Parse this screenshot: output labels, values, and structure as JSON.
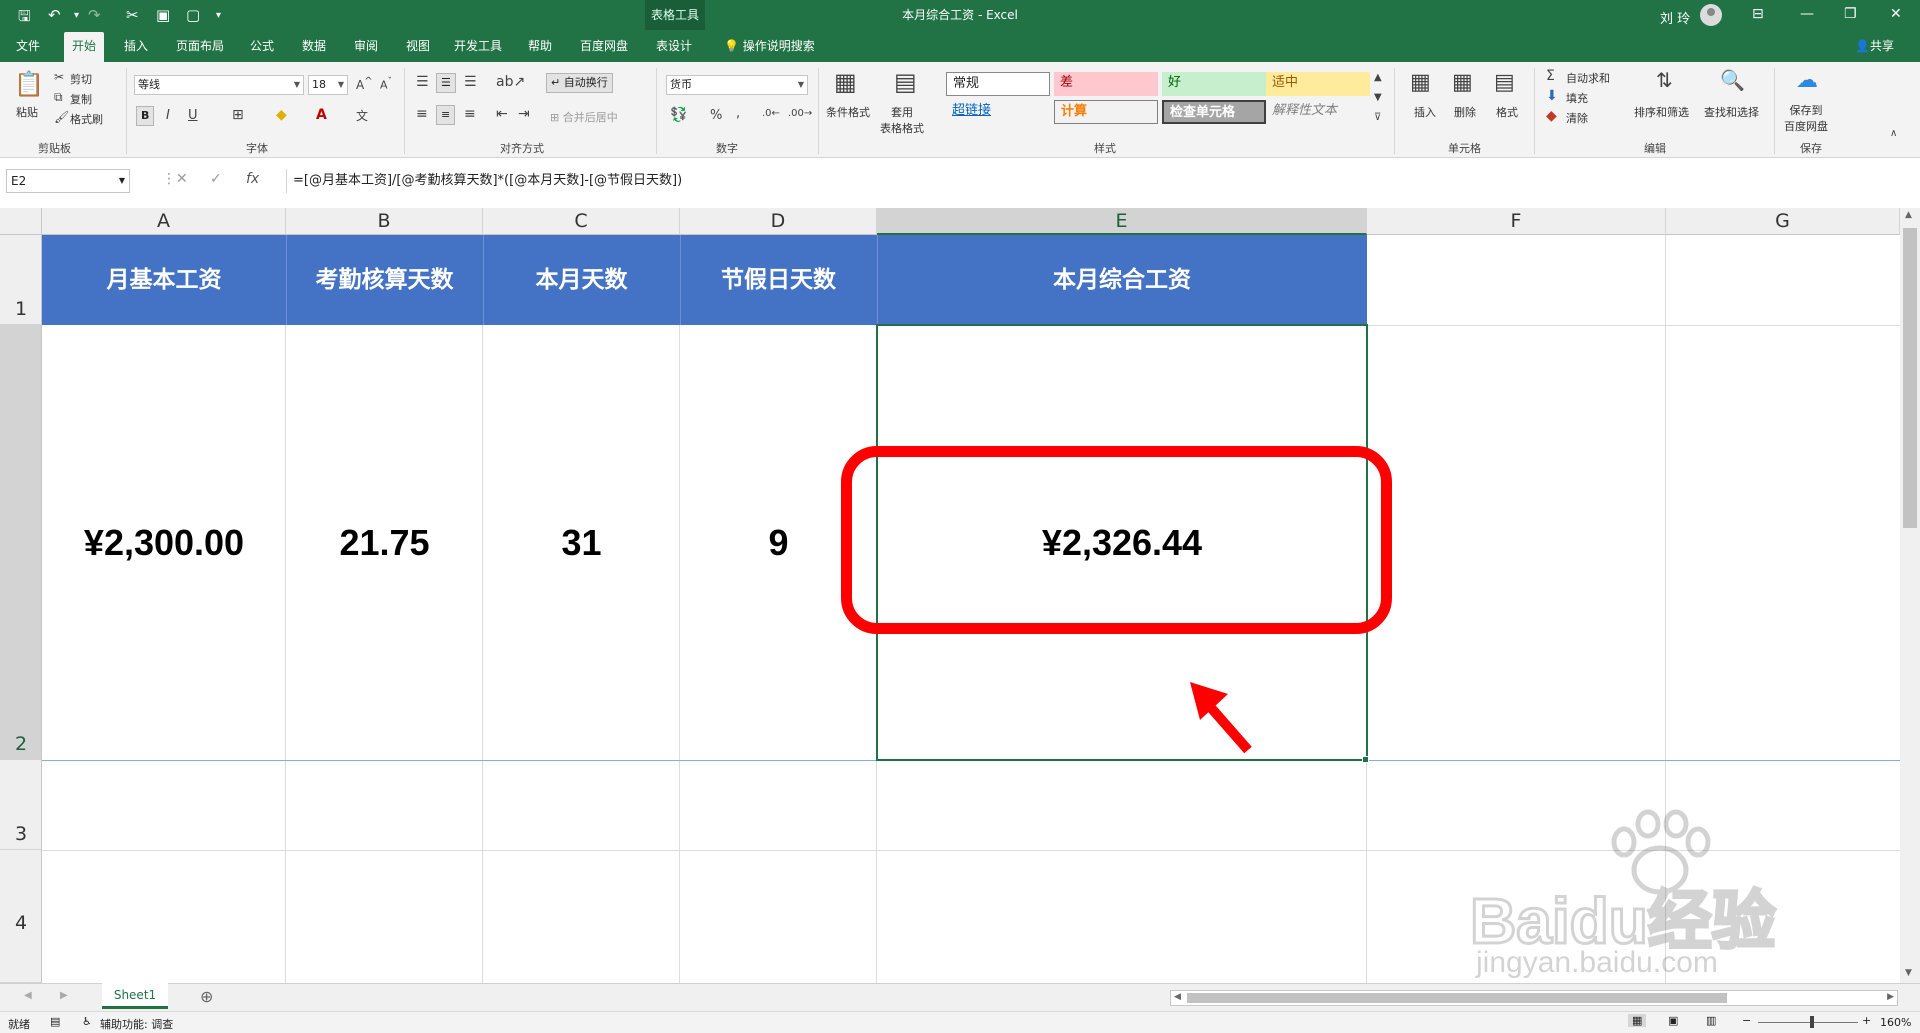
{
  "titlebar": {
    "doc_title": "本月综合工资  -  Excel",
    "context_tool": "表格工具",
    "user": "刘 玲"
  },
  "tabs": [
    "文件",
    "开始",
    "插入",
    "页面布局",
    "公式",
    "数据",
    "审阅",
    "视图",
    "开发工具",
    "帮助",
    "百度网盘",
    "表设计"
  ],
  "active_tab": "开始",
  "tell_me": "操作说明搜索",
  "share_label": "共享",
  "ribbon": {
    "clipboard": {
      "paste": "粘贴",
      "cut": "剪切",
      "copy": "复制",
      "format_painter": "格式刷",
      "label": "剪贴板"
    },
    "font": {
      "name": "等线",
      "size": "18",
      "label": "字体"
    },
    "alignment": {
      "wrap": "自动换行",
      "merge": "合并后居中",
      "label": "对齐方式"
    },
    "number": {
      "format": "货币",
      "label": "数字"
    },
    "styles": {
      "conditional": "条件格式",
      "table_format": "套用\n表格格式",
      "cells": {
        "normal": "常规",
        "bad": "差",
        "good": "好",
        "neutral": "适中",
        "hyperlink": "超链接",
        "calc": "计算",
        "check": "检查单元格",
        "explain": "解释性文本"
      },
      "label": "样式"
    },
    "cells": {
      "insert": "插入",
      "delete": "删除",
      "format": "格式",
      "label": "单元格"
    },
    "editing": {
      "autosum": "自动求和",
      "fill": "填充",
      "clear": "清除",
      "sort": "排序和筛选",
      "find": "查找和选择",
      "label": "编辑"
    },
    "save": {
      "save_to": "保存到\n百度网盘",
      "label": "保存"
    }
  },
  "formula_bar": {
    "name_box": "E2",
    "formula": "=[@月基本工资]/[@考勤核算天数]*([@本月天数]-[@节假日天数])"
  },
  "columns": [
    "A",
    "B",
    "C",
    "D",
    "E",
    "F",
    "G"
  ],
  "rows": [
    "1",
    "2",
    "3",
    "4"
  ],
  "table": {
    "headers": [
      "月基本工资",
      "考勤核算天数",
      "本月天数",
      "节假日天数",
      "本月综合工资"
    ],
    "values": [
      "¥2,300.00",
      "21.75",
      "31",
      "9",
      "¥2,326.44"
    ]
  },
  "sheet_tabs": [
    "Sheet1"
  ],
  "status": {
    "ready": "就绪",
    "accessibility": "辅助功能: 调查",
    "zoom": "160%"
  },
  "watermark": {
    "text": "Baidu经验",
    "sub": "jingyan.baidu.com"
  },
  "colors": {
    "excel_green": "#217346",
    "table_header_blue": "#4472c4",
    "annotation_red": "#ff0000"
  }
}
